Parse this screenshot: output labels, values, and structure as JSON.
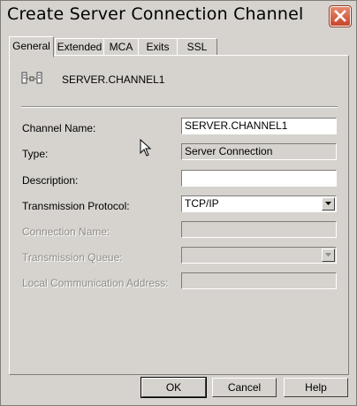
{
  "window": {
    "title": "Create Server Connection Channel"
  },
  "tabs": [
    {
      "label": "General",
      "active": true
    },
    {
      "label": "Extended",
      "active": false
    },
    {
      "label": "MCA",
      "active": false
    },
    {
      "label": "Exits",
      "active": false
    },
    {
      "label": "SSL",
      "active": false
    }
  ],
  "header": {
    "channel": "SERVER.CHANNEL1",
    "icon": "channel-icon"
  },
  "form": {
    "channel_name": {
      "label": "Channel Name:",
      "value": "SERVER.CHANNEL1"
    },
    "type": {
      "label": "Type:",
      "value": "Server Connection"
    },
    "description": {
      "label": "Description:",
      "value": ""
    },
    "transmission_protocol": {
      "label": "Transmission Protocol:",
      "value": "TCP/IP"
    },
    "connection_name": {
      "label": "Connection Name:",
      "value": "",
      "enabled": false
    },
    "transmission_queue": {
      "label": "Transmission Queue:",
      "value": "",
      "enabled": false
    },
    "local_communication_address": {
      "label": "Local Communication Address:",
      "value": "",
      "enabled": false
    }
  },
  "buttons": {
    "ok": "OK",
    "cancel": "Cancel",
    "help": "Help"
  },
  "colors": {
    "dialog_bg": "#d6d3ce",
    "close_button": "#c8452a",
    "disabled_text": "#8e8c88"
  }
}
